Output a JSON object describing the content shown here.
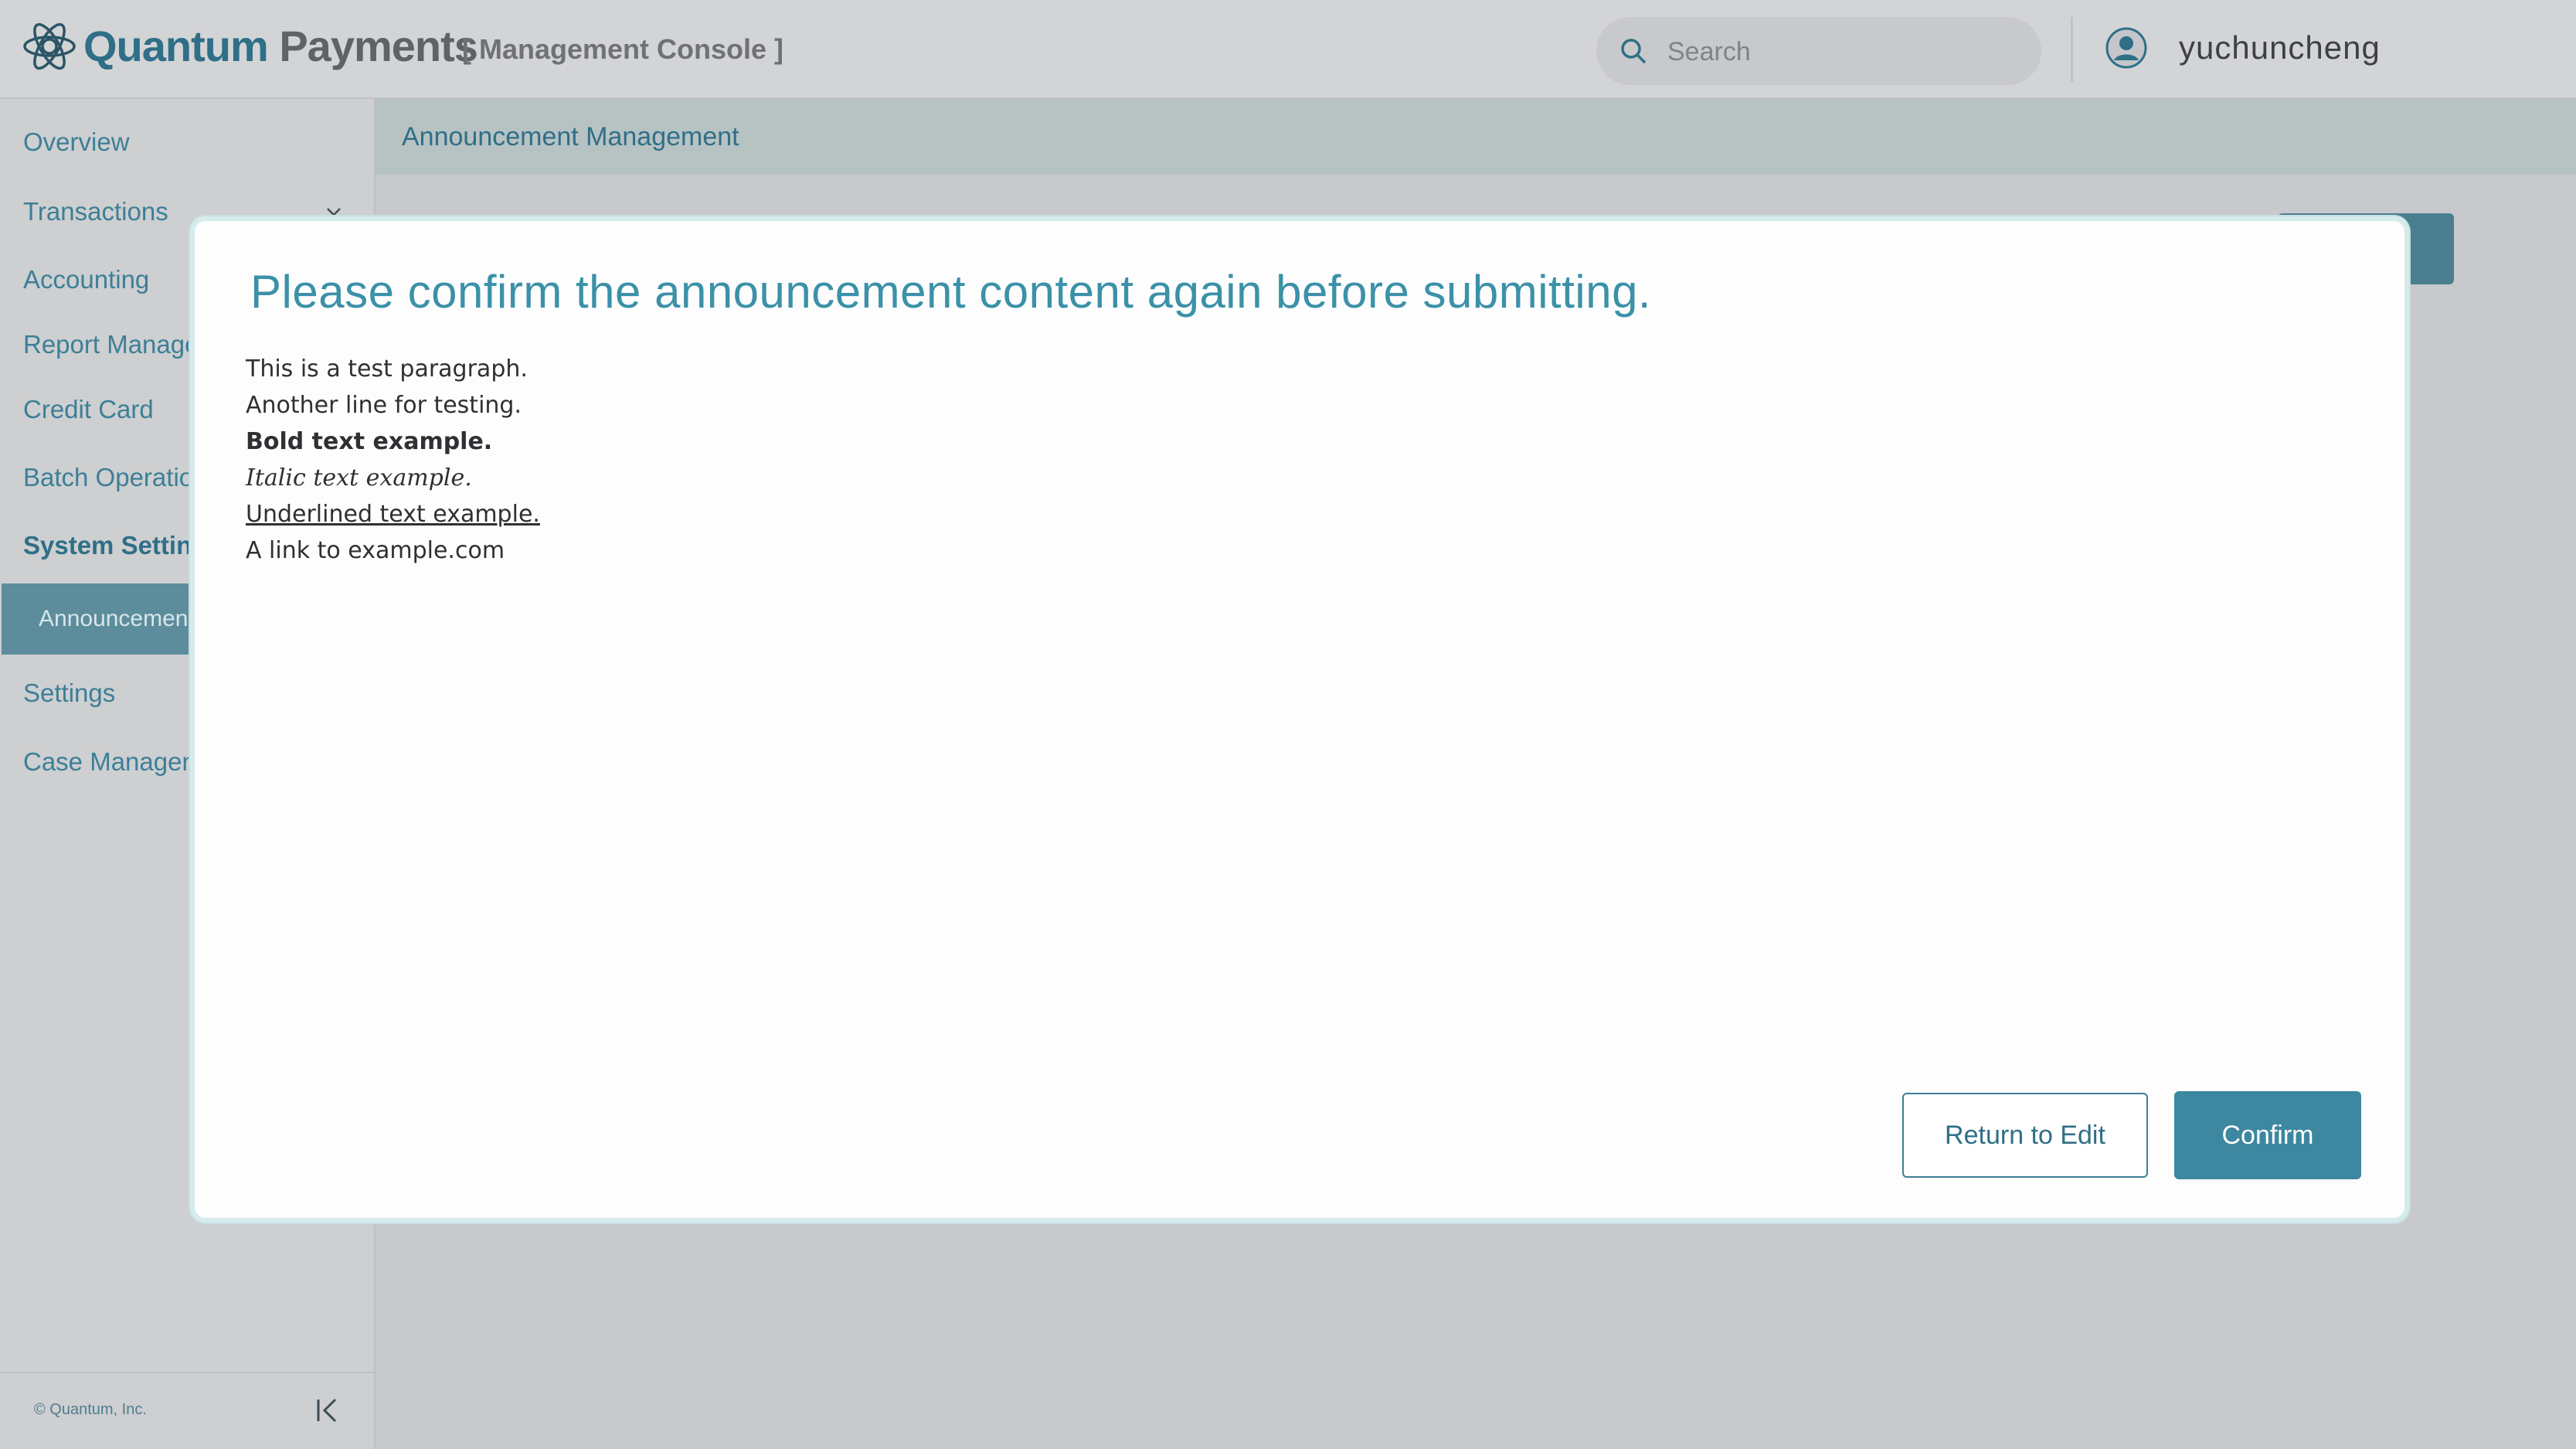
{
  "header": {
    "brand_part1": "Quantum",
    "brand_part2": "Payments",
    "console_tag": "[ Management Console ]",
    "search_placeholder": "Search",
    "username": "yuchuncheng",
    "logo_icon": "atom-icon",
    "search_icon": "search-icon",
    "avatar_icon": "user-avatar-icon"
  },
  "sidebar": {
    "items": [
      {
        "label": "Overview"
      },
      {
        "label": "Transactions"
      },
      {
        "label": "Accounting"
      },
      {
        "label": "Report Management"
      },
      {
        "label": "Credit Card"
      },
      {
        "label": "Batch Operations"
      },
      {
        "label": "System Settings"
      },
      {
        "label": "Announcement Management"
      },
      {
        "label": "Settings"
      },
      {
        "label": "Case Management"
      }
    ],
    "footer_copyright": "© Quantum, Inc.",
    "collapse_icon": "collapse-left-icon"
  },
  "main": {
    "breadcrumb": "Announcement Management"
  },
  "modal": {
    "title": "Please confirm the announcement content again before submitting.",
    "content_lines": [
      "This is a test paragraph.",
      "Another line for testing.",
      "Bold text example.",
      "Italic text example.",
      "Underlined text example.",
      "A link to example.com"
    ],
    "return_button": "Return to Edit",
    "confirm_button": "Confirm"
  },
  "colors": {
    "accent": "#3d87a0",
    "brand_dark": "#2f6f87",
    "overlay_bg": "#c7c9cc",
    "modal_border": "#d6ecec"
  }
}
